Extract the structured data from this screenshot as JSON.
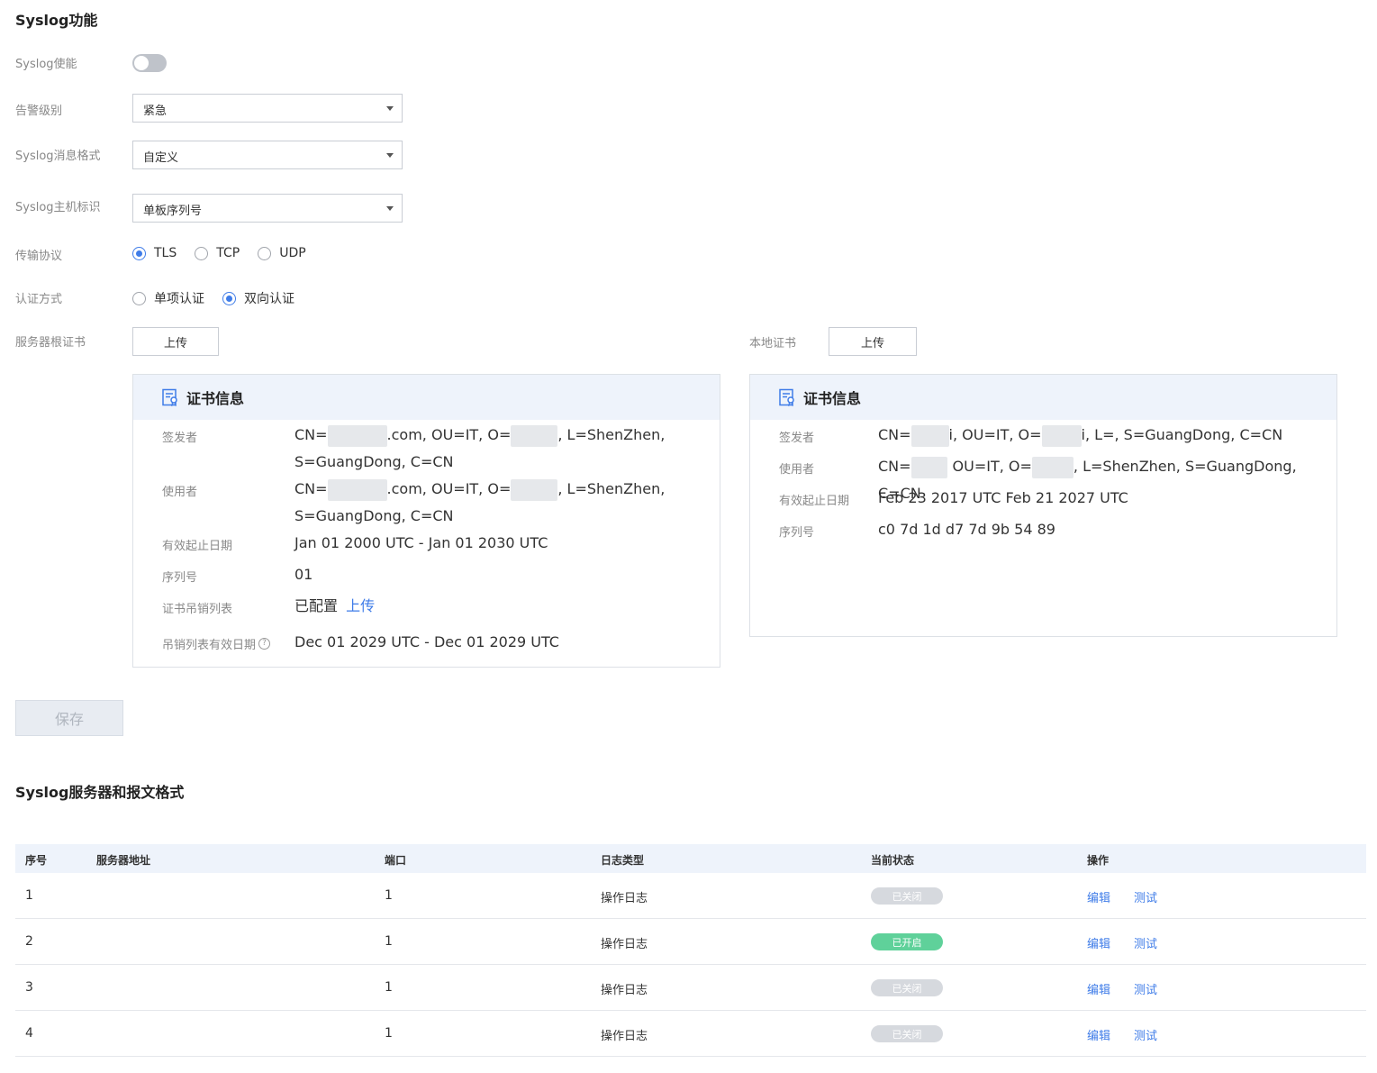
{
  "syslog_section": {
    "title": "Syslog功能",
    "enable_label": "Syslog使能",
    "alarm_level": {
      "label": "告警级别",
      "value": "紧急"
    },
    "message_format": {
      "label": "Syslog消息格式",
      "value": "自定义"
    },
    "host_id": {
      "label": "Syslog主机标识",
      "value": "单板序列号"
    },
    "protocol": {
      "label": "传输协议",
      "options": [
        "TLS",
        "TCP",
        "UDP"
      ],
      "selected": "TLS"
    },
    "auth": {
      "label": "认证方式",
      "options": [
        "单项认证",
        "双向认证"
      ],
      "selected": "双向认证"
    },
    "server_root_cert": {
      "label": "服务器根证书",
      "upload_label": "上传"
    },
    "local_cert": {
      "label": "本地证书",
      "upload_label": "上传"
    }
  },
  "server_cert_card": {
    "title": "证书信息",
    "issuer_label": "签发者",
    "issuer_part1": "CN=",
    "issuer_part2": ".com, OU=IT, O=",
    "issuer_part3": ", L=ShenZhen,",
    "issuer_line2": "S=GuangDong, C=CN",
    "subject_label": "使用者",
    "subject_part1": "CN=",
    "subject_part2": ".com, OU=IT, O=",
    "subject_part3": ", L=ShenZhen,",
    "subject_line2": "S=GuangDong, C=CN",
    "validity_label": "有效起止日期",
    "validity": "Jan 01 2000 UTC - Jan 01 2030 UTC",
    "serial_label": "序列号",
    "serial": "01",
    "crl_label": "证书吊销列表",
    "crl_status": "已配置",
    "crl_upload": "上传",
    "crl_validity_label": "吊销列表有效日期",
    "crl_validity": "Dec 01 2029 UTC - Dec 01 2029 UTC"
  },
  "local_cert_card": {
    "title": "证书信息",
    "issuer_label": "签发者",
    "issuer_part1": "CN=",
    "issuer_part2": "i, OU=IT, O=",
    "issuer_part3": "i, L=, S=GuangDong, C=CN",
    "subject_label": "使用者",
    "subject_part1": "CN=",
    "subject_part2": "OU=IT, O=",
    "subject_part3": ", L=ShenZhen, S=GuangDong, C=CN",
    "validity_label": "有效起止日期",
    "validity": "Feb 23 2017 UTC Feb 21 2027 UTC",
    "serial_label": "序列号",
    "serial": "c0 7d 1d d7 7d 9b 54 89"
  },
  "save_label": "保存",
  "server_section": {
    "title": "Syslog服务器和报文格式",
    "columns": [
      "序号",
      "服务器地址",
      "端口",
      "日志类型",
      "当前状态",
      "操作"
    ],
    "rows": [
      {
        "index": "1",
        "address": "",
        "port": "1",
        "log_type": "操作日志",
        "status": "已关闭",
        "edit": "编辑",
        "test": "测试"
      },
      {
        "index": "2",
        "address": "",
        "port": "1",
        "log_type": "操作日志",
        "status": "已开启",
        "edit": "编辑",
        "test": "测试"
      },
      {
        "index": "3",
        "address": "",
        "port": "1",
        "log_type": "操作日志",
        "status": "已关闭",
        "edit": "编辑",
        "test": "测试"
      },
      {
        "index": "4",
        "address": "",
        "port": "1",
        "log_type": "操作日志",
        "status": "已关闭",
        "edit": "编辑",
        "test": "测试"
      }
    ]
  },
  "colors": {
    "accent": "#3f7ce8",
    "status_on": "#5fd19a",
    "status_off": "#d6d9de",
    "card_header": "#eef3fb"
  }
}
